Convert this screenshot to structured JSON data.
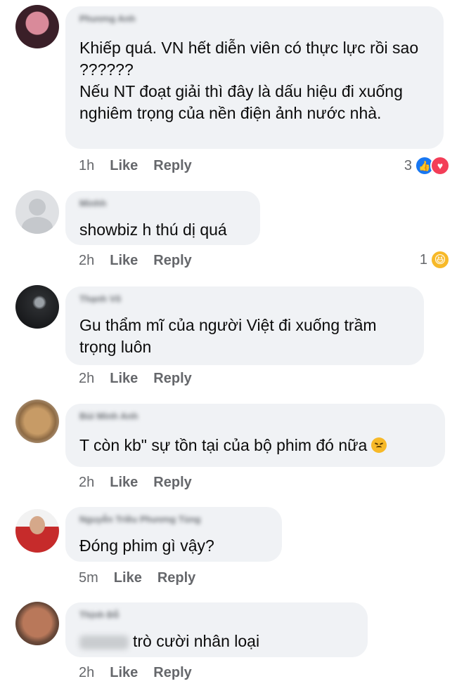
{
  "comments": [
    {
      "author": "Phương Anh",
      "text": "Khiếp quá. VN hết diễn viên có thực lực rồi sao ??????\nNếu NT đoạt giải thì đây là dấu hiệu đi xuống nghiêm trọng của nền điện ảnh nước nhà.",
      "time": "1h",
      "like": "Like",
      "reply": "Reply",
      "reaction_count": "3",
      "reactions": [
        "like-icon",
        "love-icon"
      ]
    },
    {
      "author": "Minhh",
      "text": "showbiz h thú dị quá",
      "time": "2h",
      "like": "Like",
      "reply": "Reply",
      "reaction_count": "1",
      "reactions": [
        "haha-icon"
      ]
    },
    {
      "author": "Thạnh Võ",
      "text": "Gu thẩm mĩ của người Việt đi xuống trầm trọng luôn",
      "time": "2h",
      "like": "Like",
      "reply": "Reply"
    },
    {
      "author": "Bùi Minh Anh",
      "text": "T còn kb\" sự tồn tại của bộ phim đó nữa",
      "time": "2h",
      "like": "Like",
      "reply": "Reply",
      "inline_emoji": "disappointed-face-icon"
    },
    {
      "author": "Nguyễn Triều Phương Tùng",
      "text": "Đóng phim gì vậy?",
      "time": "5m",
      "like": "Like",
      "reply": "Reply"
    },
    {
      "author": "Thịnh Đỗ",
      "text": "trò cười nhân loại",
      "time": "2h",
      "like": "Like",
      "reply": "Reply"
    }
  ],
  "colors": {
    "bubble": "#f0f2f5",
    "meta_text": "#65676b",
    "like_blue": "#1877f2",
    "love_red": "#f33e58",
    "haha_yellow": "#f7b928"
  }
}
